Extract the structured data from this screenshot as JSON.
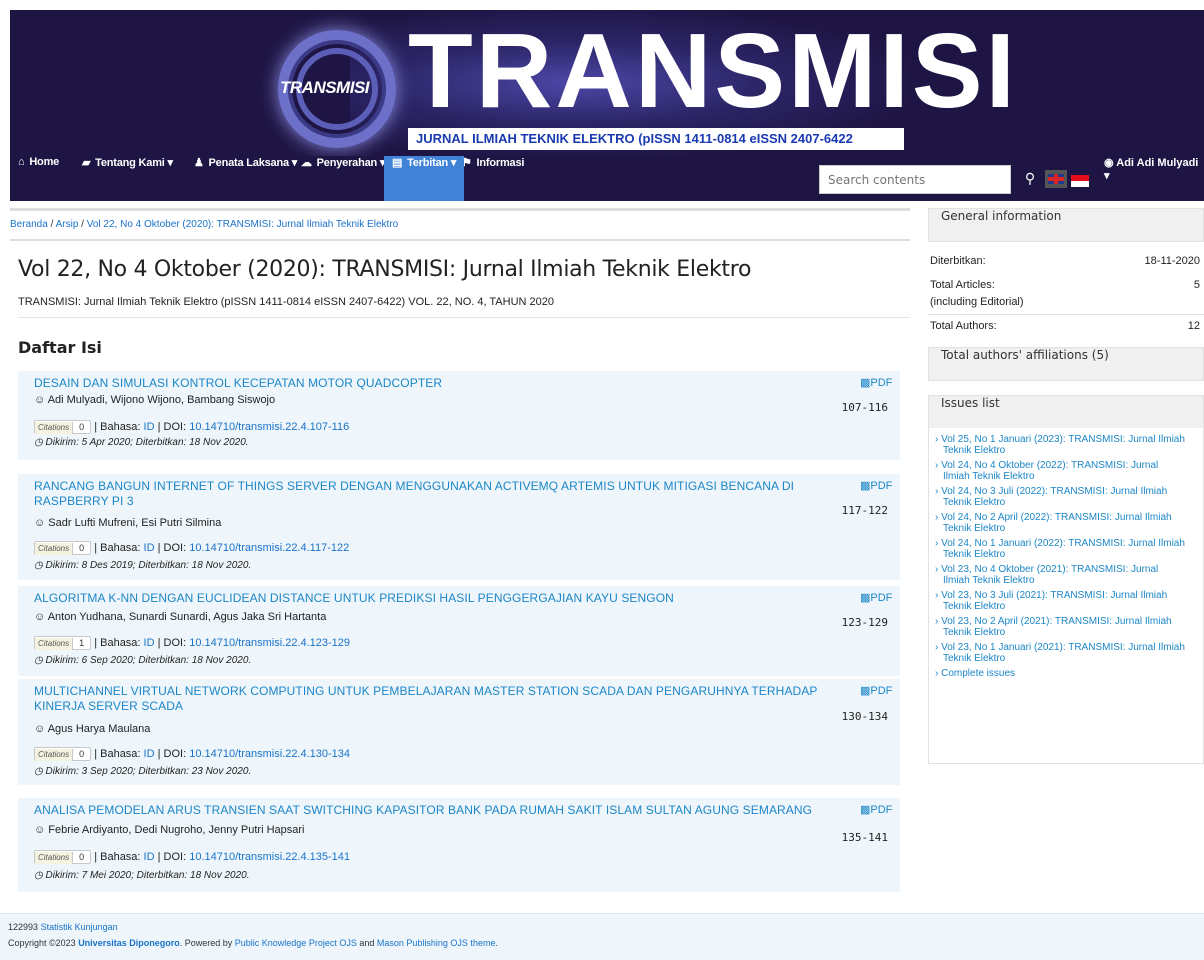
{
  "banner": {
    "logo_text": "TRANSMISI",
    "title": "TRANSMISI",
    "subtitle": "JURNAL ILMIAH TEKNIK ELEKTRO (pISSN 1411-0814 eISSN 2407-6422"
  },
  "nav": {
    "home": "Home",
    "about": "Tentang Kami",
    "editorial": "Penata Laksana",
    "submission": "Penyerahan",
    "issues": "Terbitan",
    "info": "Informasi",
    "search_placeholder": "Search contents",
    "user": "Adi Adi Mulyadi"
  },
  "breadcrumb": {
    "home": "Beranda",
    "archive": "Arsip",
    "current": "Vol 22, No 4 Oktober (2020): TRANSMISI: Jurnal Ilmiah Teknik Elektro"
  },
  "issue": {
    "title": "Vol 22, No 4 Oktober (2020): TRANSMISI: Jurnal Ilmiah Teknik Elektro",
    "description": "TRANSMISI: Jurnal Ilmiah Teknik Elektro (pISSN 1411-0814 eISSN 2407-6422) VOL. 22, NO. 4, TAHUN 2020",
    "toc_heading": "Daftar Isi"
  },
  "labels": {
    "pdf": "PDF",
    "citations": "Citations",
    "bahasa": "| Bahasa:",
    "doi": "| DOI:"
  },
  "articles": [
    {
      "title": "DESAIN DAN SIMULASI KONTROL KECEPATAN MOTOR QUADCOPTER",
      "authors": "Adi Mulyadi, Wijono Wijono, Bambang Siswojo",
      "citations": "0",
      "lang": "ID",
      "doi": "10.14710/transmisi.22.4.107-116",
      "dates": "Dikirim: 5 Apr 2020; Diterbitkan: 18 Nov 2020.",
      "pages": "107-116"
    },
    {
      "title": "RANCANG BANGUN INTERNET OF THINGS SERVER DENGAN MENGGUNAKAN ACTIVEMQ ARTEMIS UNTUK MITIGASI BENCANA DI RASPBERRY PI 3",
      "authors": "Sadr Lufti Mufreni, Esi Putri Silmina",
      "citations": "0",
      "lang": "ID",
      "doi": "10.14710/transmisi.22.4.117-122",
      "dates": "Dikirim: 8 Des 2019; Diterbitkan: 18 Nov 2020.",
      "pages": "117-122"
    },
    {
      "title": "ALGORITMA K-NN DENGAN EUCLIDEAN DISTANCE UNTUK PREDIKSI HASIL PENGGERGAJIAN KAYU SENGON",
      "authors": "Anton Yudhana, Sunardi Sunardi, Agus Jaka Sri Hartanta",
      "citations": "1",
      "lang": "ID",
      "doi": "10.14710/transmisi.22.4.123-129",
      "dates": "Dikirim: 6 Sep 2020; Diterbitkan: 18 Nov 2020.",
      "pages": "123-129"
    },
    {
      "title": "MULTICHANNEL VIRTUAL NETWORK COMPUTING UNTUK PEMBELAJARAN MASTER STATION SCADA DAN PENGARUHNYA TERHADAP KINERJA SERVER SCADA",
      "authors": "Agus Harya Maulana",
      "citations": "0",
      "lang": "ID",
      "doi": "10.14710/transmisi.22.4.130-134",
      "dates": "Dikirim: 3 Sep 2020; Diterbitkan: 23 Nov 2020.",
      "pages": "130-134"
    },
    {
      "title": "ANALISA PEMODELAN ARUS TRANSIEN SAAT SWITCHING KAPASITOR BANK PADA RUMAH SAKIT ISLAM SULTAN AGUNG SEMARANG",
      "authors": "Febrie Ardiyanto, Dedi Nugroho, Jenny Putri Hapsari",
      "citations": "0",
      "lang": "ID",
      "doi": "10.14710/transmisi.22.4.135-141",
      "dates": "Dikirim: 7 Mei 2020; Diterbitkan: 18 Nov 2020.",
      "pages": "135-141"
    }
  ],
  "sidebar": {
    "general_heading": "General information",
    "published_label": "Diterbitkan:",
    "published_value": "18-11-2020",
    "total_articles_label": "Total Articles:",
    "total_articles_note": "(including Editorial)",
    "total_articles_value": "5",
    "total_authors_label": "Total Authors:",
    "total_authors_value": "12",
    "affiliations_heading": "Total authors' affiliations (5)",
    "issues_heading": "Issues list",
    "issues": [
      "› Vol 25, No 1 Januari (2023): TRANSMISI: Jurnal Ilmiah Teknik Elektro",
      "› Vol 24, No 4 Oktober (2022): TRANSMISI: Jurnal Ilmiah Teknik Elektro",
      "› Vol 24, No 3 Juli (2022): TRANSMISI: Jurnal Ilmiah Teknik Elektro",
      "› Vol 24, No 2 April (2022): TRANSMISI: Jurnal Ilmiah Teknik Elektro",
      "› Vol 24, No 1 Januari (2022): TRANSMISI: Jurnal Ilmiah Teknik Elektro",
      "› Vol 23, No 4 Oktober (2021): TRANSMISI: Jurnal Ilmiah Teknik Elektro",
      "› Vol 23, No 3 Juli (2021): TRANSMISI: Jurnal Ilmiah Teknik Elektro",
      "› Vol 23, No 2 April (2021): TRANSMISI: Jurnal Ilmiah Teknik Elektro",
      "› Vol 23, No 1 Januari (2021): TRANSMISI: Jurnal Ilmiah Teknik Elektro",
      "› Complete issues"
    ]
  },
  "footer": {
    "visits": "122993",
    "stats_link": "Statistik Kunjungan",
    "copyright_prefix": "Copyright ©2023",
    "university": "Universitas Diponegoro",
    "powered_by": ". Powered by",
    "pkp": "Public Knowledge Project OJS",
    "and": "and",
    "theme": "Mason Publishing OJS theme",
    "end": "."
  }
}
